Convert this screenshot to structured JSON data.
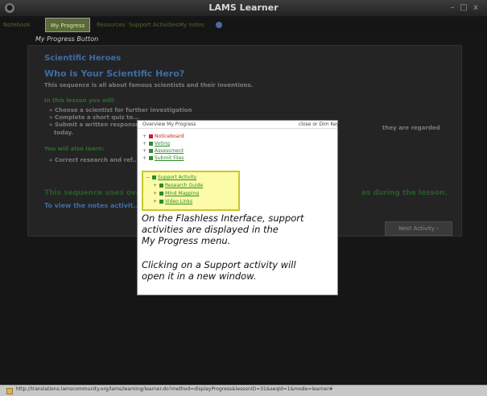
{
  "window": {
    "title": "LAMS Learner",
    "controls": [
      "–",
      "□",
      "x"
    ]
  },
  "tabs": {
    "t0": "Notebook",
    "t1": "My Progress",
    "t2": "Resources",
    "t3": "Support Activities",
    "t4": "My notes"
  },
  "panel": {
    "title": "My Progress Button",
    "lesson_title": "Scientific Heroes",
    "heading": "Who is Your Scientific Hero?",
    "intro": "This sequence is all about famous scientists and their inventions.",
    "list_heading": "In this lesson you will:",
    "items": [
      "Choose a scientist for further investigation",
      "Complete a short quiz to...",
      "Submit a written response..."
    ],
    "items_tail": "they are regarded",
    "items_tail2": "today.",
    "second_heading": "You will also learn:",
    "second_item": "Correct research and ref...",
    "bottom_green": "This sequence uses over...",
    "bottom_green_tail": "as during the lesson.",
    "view_link": "To view the notes activit...",
    "next_button": "Next Activity  ›"
  },
  "overlay": {
    "top_left": "Overview   My Progress",
    "top_right": "close or Dim Key",
    "tree": [
      {
        "label": "Noticeboard",
        "color": "red"
      },
      {
        "label": "Voting",
        "color": "green"
      },
      {
        "label": "Assessment",
        "color": "green"
      },
      {
        "label": "Submit Files",
        "color": "green"
      }
    ],
    "support": {
      "label": "Support Activity",
      "children": [
        "Research Guide",
        "Mind Mapping",
        "Video Links"
      ]
    },
    "caption1": [
      "On the Flashless Interface, support",
      "activities are displayed in the",
      "My Progress menu."
    ],
    "caption2": [
      "Clicking on a Support activity will",
      "open it in a new window."
    ]
  },
  "status": {
    "url": "http://translations.lamscommunity.org/lams/learning/learner.do?method=displayProgress&lessonID=31&seqId=1&mode=learner#"
  },
  "colors": {
    "accent_blue": "#3e6ca6",
    "done_green": "#2e8a2e",
    "current_red": "#c82020",
    "highlight_yellow": "#fbfba8"
  }
}
